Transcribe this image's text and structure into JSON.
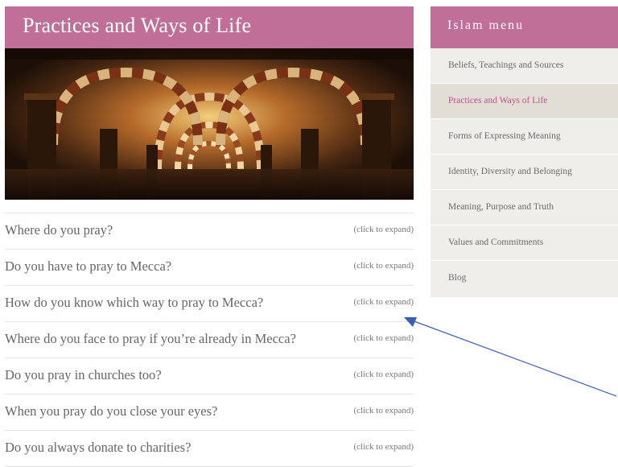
{
  "page": {
    "title": "Practices and Ways of Life"
  },
  "faq": {
    "items": [
      {
        "question": "Where do you pray?",
        "hint": "(click to expand)"
      },
      {
        "question": "Do you have to pray to Mecca?",
        "hint": "(click to expand)"
      },
      {
        "question": "How do you know which way to pray to Mecca?",
        "hint": "(click to expand)"
      },
      {
        "question": "Where do you face to pray if you’re already in Mecca?",
        "hint": "(click to expand)"
      },
      {
        "question": "Do you pray in churches too?",
        "hint": "(click to expand)"
      },
      {
        "question": "When you pray do you close your eyes?",
        "hint": "(click to expand)"
      },
      {
        "question": "Do you always donate to charities?",
        "hint": "(click to expand)"
      }
    ]
  },
  "sidebar": {
    "title": "Islam menu",
    "items": [
      {
        "label": "Beliefs, Teachings and Sources"
      },
      {
        "label": "Practices and Ways of Life",
        "active": true
      },
      {
        "label": "Forms of Expressing Meaning"
      },
      {
        "label": "Identity, Diversity and Belonging"
      },
      {
        "label": "Meaning, Purpose and Truth"
      },
      {
        "label": "Values and Commitments"
      },
      {
        "label": "Blog"
      }
    ]
  },
  "colors": {
    "brand": "#c07098",
    "active_link": "#c0508a",
    "arrow": "#3a5fb0"
  }
}
